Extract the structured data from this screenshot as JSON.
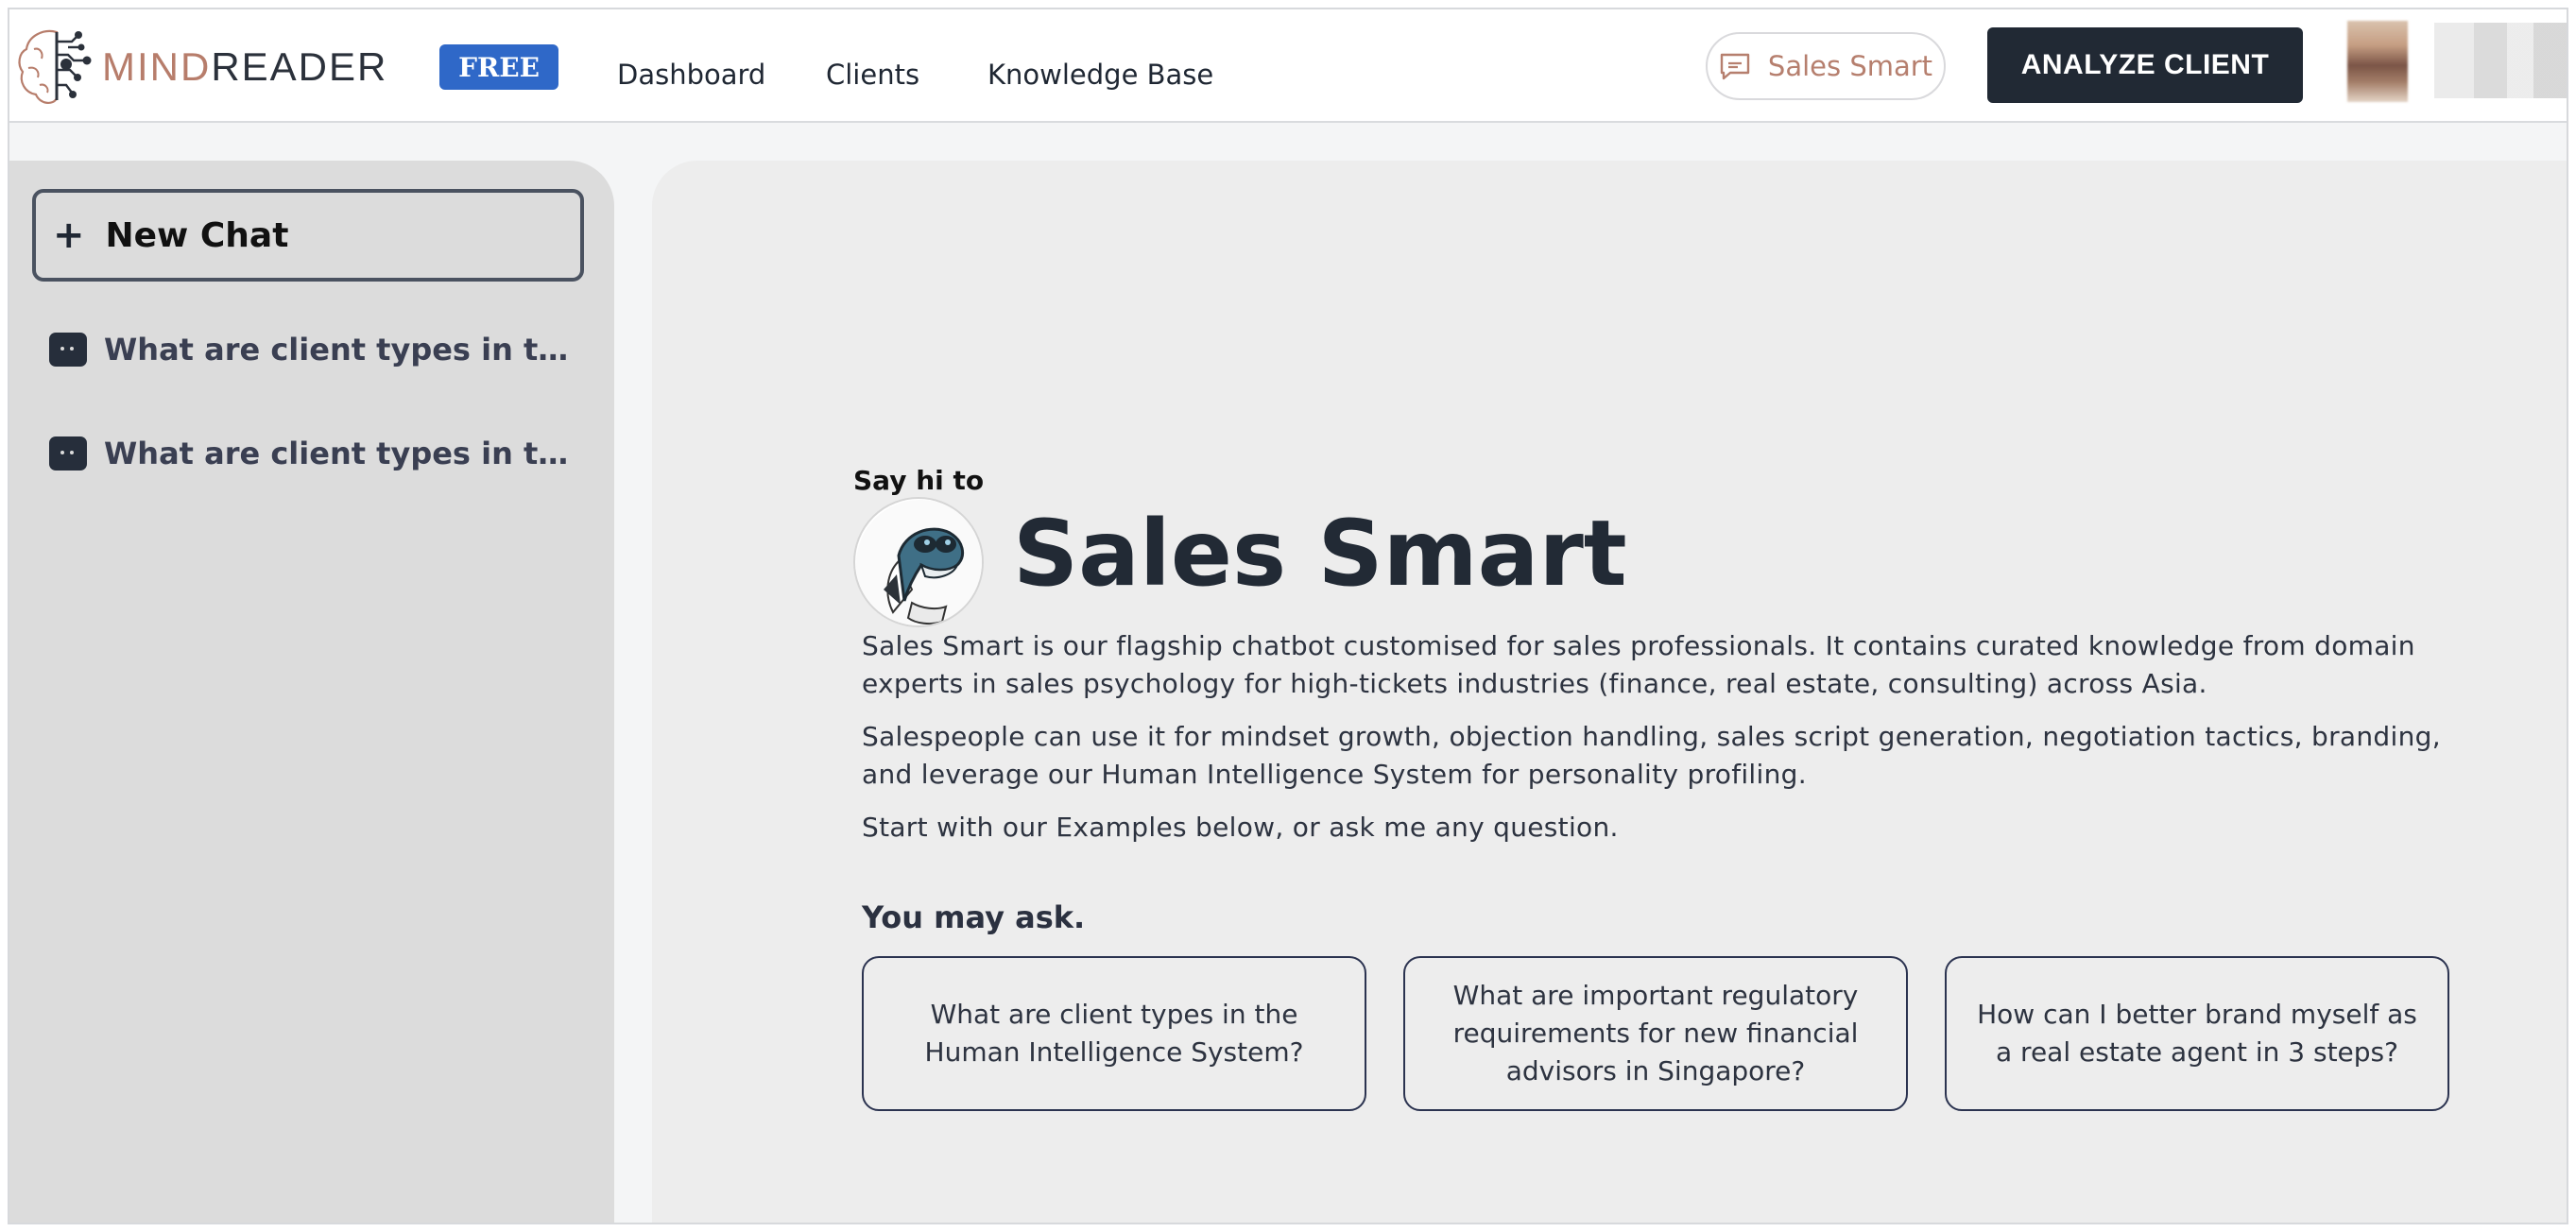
{
  "header": {
    "brand_mind": "MIND",
    "brand_reader": "READER",
    "plan_badge": "FREE",
    "nav": [
      {
        "label": "Dashboard"
      },
      {
        "label": "Clients"
      },
      {
        "label": "Knowledge Base"
      }
    ],
    "assistant_pill": "Sales Smart",
    "analyze_button": "ANALYZE CLIENT"
  },
  "sidebar": {
    "new_chat_label": "New Chat",
    "history": [
      {
        "title": "What are client types in the Human Intelligence System?"
      },
      {
        "title": "What are client types in the Human Intelligence System?"
      }
    ]
  },
  "main": {
    "greeting": "Say hi to",
    "bot_name": "Sales Smart",
    "paragraphs": [
      "Sales Smart is our flagship chatbot customised for sales professionals. It contains curated knowledge from domain experts in sales psychology for high-tickets industries (finance, real estate, consulting) across Asia.",
      "Salespeople can use it for mindset growth, objection handling, sales script generation, negotiation tactics, branding, and leverage our Human Intelligence System for personality profiling.",
      "Start with our Examples below, or ask me any question."
    ],
    "suggestions_title": "You may ask.",
    "suggestions": [
      "What are client types in the Human Intelligence System?",
      "What are important regulatory requirements for new financial advisors in Singapore?",
      "How can I better brand myself as a real estate agent in 3 steps?"
    ]
  },
  "colors": {
    "brand_accent": "#b77d6b",
    "badge_blue": "#2f68c8",
    "dark_button": "#212934",
    "sidebar_bg": "#dcdcdc",
    "main_bg": "#ededed"
  }
}
